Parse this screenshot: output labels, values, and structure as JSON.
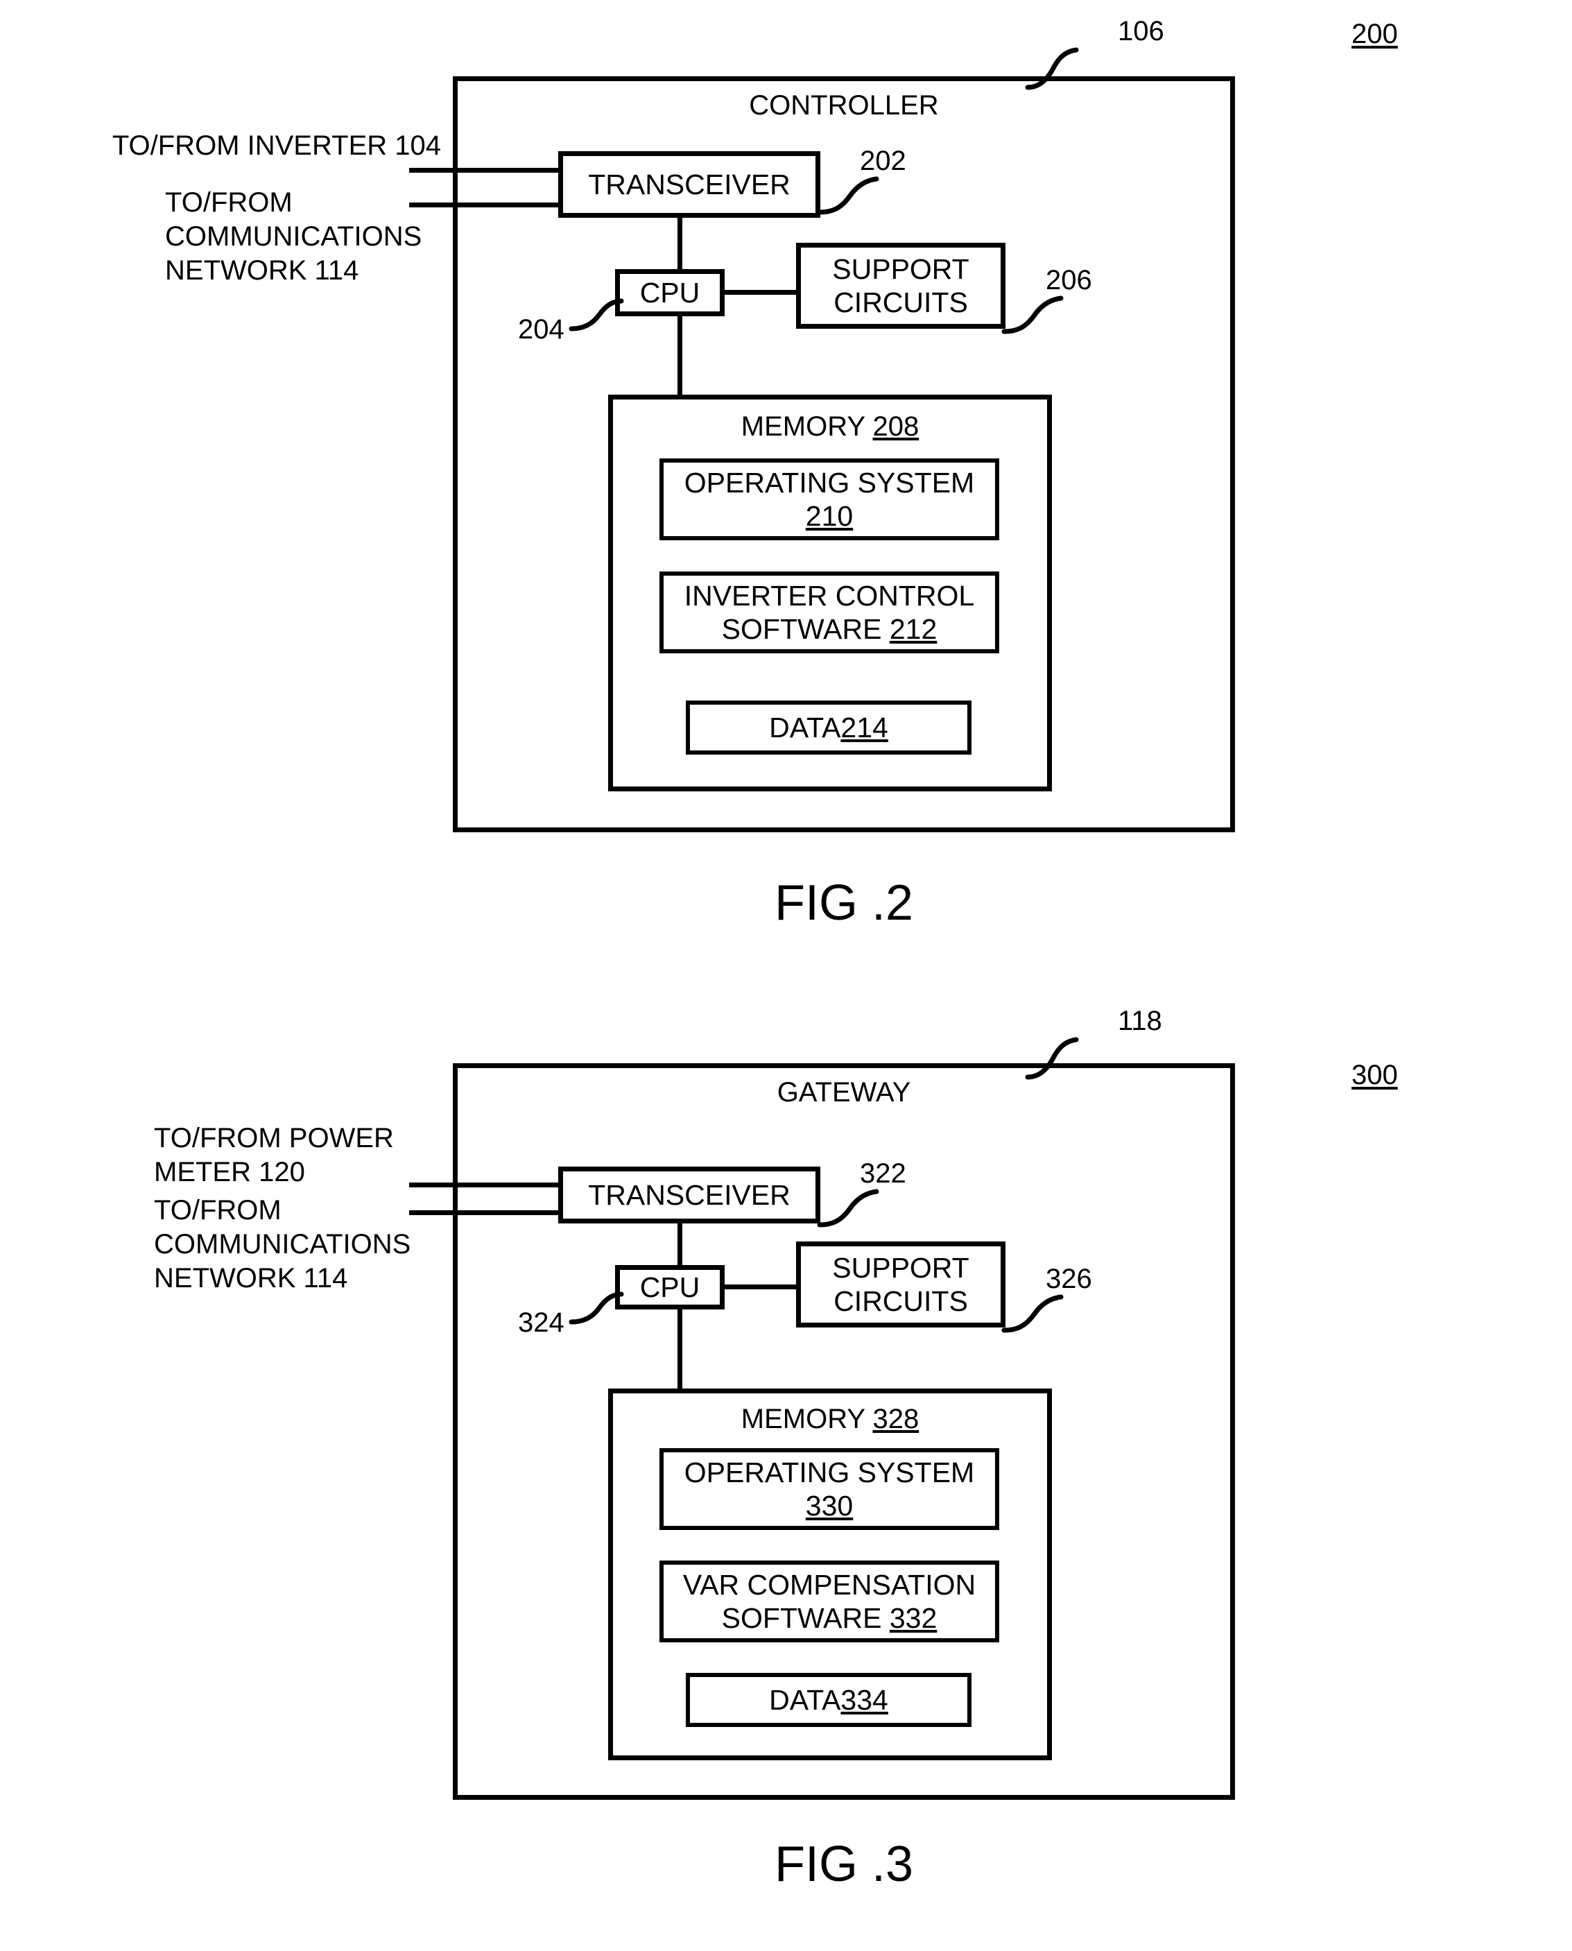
{
  "figures": [
    {
      "id": "fig2",
      "caption": "FIG .2",
      "diagram_number": "200",
      "container": {
        "title": "CONTROLLER",
        "ref": "106"
      },
      "inputs": [
        {
          "label": "TO/FROM INVERTER 104"
        },
        {
          "label": "TO/FROM\nCOMMUNICATIONS\nNETWORK 114"
        }
      ],
      "blocks": {
        "transceiver": {
          "label": "TRANSCEIVER",
          "ref": "202"
        },
        "cpu": {
          "label": "CPU",
          "ref": "204"
        },
        "support_circuits": {
          "label": "SUPPORT\nCIRCUITS",
          "ref": "206"
        },
        "memory": {
          "label": "MEMORY",
          "ref": "208"
        },
        "operating_system": {
          "label": "OPERATING SYSTEM",
          "ref": "210"
        },
        "software": {
          "label": "INVERTER CONTROL\nSOFTWARE",
          "ref": "212"
        },
        "data": {
          "label": "DATA",
          "ref": "214"
        }
      }
    },
    {
      "id": "fig3",
      "caption": "FIG .3",
      "diagram_number": "300",
      "container": {
        "title": "GATEWAY",
        "ref": "118"
      },
      "inputs": [
        {
          "label": "TO/FROM POWER\n METER 120"
        },
        {
          "label": "TO/FROM\nCOMMUNICATIONS\nNETWORK 114"
        }
      ],
      "blocks": {
        "transceiver": {
          "label": "TRANSCEIVER",
          "ref": "322"
        },
        "cpu": {
          "label": "CPU",
          "ref": "324"
        },
        "support_circuits": {
          "label": "SUPPORT\nCIRCUITS",
          "ref": "326"
        },
        "memory": {
          "label": "MEMORY",
          "ref": "328"
        },
        "operating_system": {
          "label": "OPERATING SYSTEM",
          "ref": "330"
        },
        "software": {
          "label": "VAR COMPENSATION\nSOFTWARE",
          "ref": "332"
        },
        "data": {
          "label": "DATA",
          "ref": "334"
        }
      }
    }
  ],
  "colors": {
    "ink": "#000000",
    "paper": "#ffffff"
  }
}
